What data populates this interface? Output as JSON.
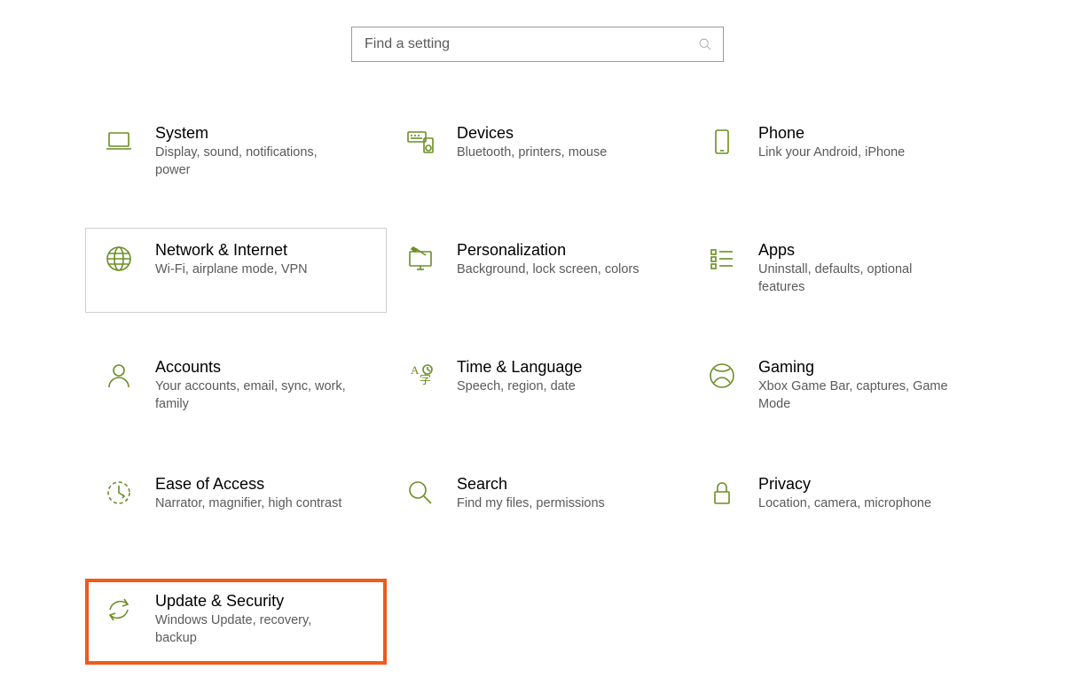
{
  "search": {
    "placeholder": "Find a setting"
  },
  "categories": [
    {
      "id": "system",
      "title": "System",
      "desc": "Display, sound, notifications, power"
    },
    {
      "id": "devices",
      "title": "Devices",
      "desc": "Bluetooth, printers, mouse"
    },
    {
      "id": "phone",
      "title": "Phone",
      "desc": "Link your Android, iPhone"
    },
    {
      "id": "network",
      "title": "Network & Internet",
      "desc": "Wi-Fi, airplane mode, VPN"
    },
    {
      "id": "personalization",
      "title": "Personalization",
      "desc": "Background, lock screen, colors"
    },
    {
      "id": "apps",
      "title": "Apps",
      "desc": "Uninstall, defaults, optional features"
    },
    {
      "id": "accounts",
      "title": "Accounts",
      "desc": "Your accounts, email, sync, work, family"
    },
    {
      "id": "time",
      "title": "Time & Language",
      "desc": "Speech, region, date"
    },
    {
      "id": "gaming",
      "title": "Gaming",
      "desc": "Xbox Game Bar, captures, Game Mode"
    },
    {
      "id": "ease",
      "title": "Ease of Access",
      "desc": "Narrator, magnifier, high contrast"
    },
    {
      "id": "search",
      "title": "Search",
      "desc": "Find my files, permissions"
    },
    {
      "id": "privacy",
      "title": "Privacy",
      "desc": "Location, camera, microphone"
    },
    {
      "id": "update",
      "title": "Update & Security",
      "desc": "Windows Update, recovery, backup"
    }
  ],
  "hover_id": "network",
  "highlight_id": "update",
  "colors": {
    "accent_icon": "#6b8e23",
    "highlight_border": "#f05a1a"
  }
}
